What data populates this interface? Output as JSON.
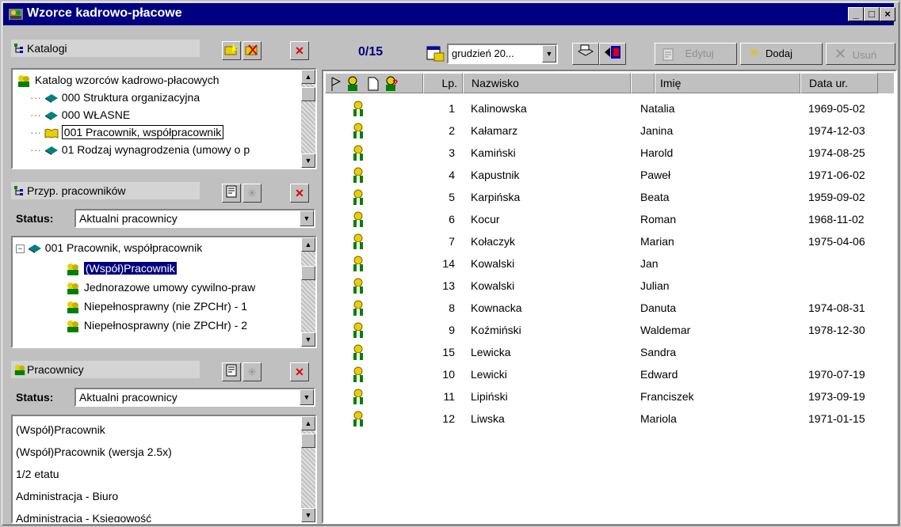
{
  "window": {
    "title": "Wzorce kadrowo-płacowe",
    "controls": [
      "_",
      "□",
      "×"
    ]
  },
  "katalogi": {
    "header": "Katalogi",
    "items": [
      {
        "label": "Katalog wzorców kadrowo-płacowych",
        "icon": "people-group-icon"
      },
      {
        "label": "000 Struktura organizacyjna",
        "icon": "book-icon"
      },
      {
        "label": "000 WŁASNE",
        "icon": "book-icon"
      },
      {
        "label": "001 Pracownik, współpracownik",
        "icon": "open-book-icon",
        "selected": true
      },
      {
        "label": "01 Rodzaj wynagrodzenia (umowy o p",
        "icon": "book-icon"
      }
    ]
  },
  "przyp": {
    "header": "Przyp. pracowników",
    "status_label": "Status:",
    "status_value": "Aktualni pracownicy",
    "items": [
      {
        "label": "001 Pracownik, współpracownik",
        "icon": "book-icon"
      },
      {
        "label": "(Współ)Pracownik",
        "icon": "people-group-icon",
        "selected": true
      },
      {
        "label": "Jednorazowe umowy cywilno-praw",
        "icon": "people-group-icon"
      },
      {
        "label": "Niepełnosprawny (nie ZPCHr) - 1",
        "icon": "people-group-icon"
      },
      {
        "label": "Niepełnosprawny (nie ZPCHr) - 2",
        "icon": "people-group-icon"
      }
    ]
  },
  "pracownicy": {
    "header": "Pracownicy",
    "status_label": "Status:",
    "status_value": "Aktualni pracownicy",
    "items": [
      "(Współ)Pracownik",
      "(Współ)Pracownik (wersja 2.5x)",
      "1/2 etatu",
      "Administracja - Biuro",
      "Administracja - Księgowość"
    ]
  },
  "toolbar": {
    "counter": "0/15",
    "month": "grudzień 20...",
    "edit_label": "Edytuj",
    "add_label": "Dodaj",
    "delete_label": "Usuń"
  },
  "grid": {
    "headers": {
      "lp": "Lp.",
      "surname": "Nazwisko",
      "name": "Imię",
      "dob": "Data ur."
    },
    "rows": [
      {
        "lp": "1",
        "surname": "Kalinowska",
        "name": "Natalia",
        "dob": "1969-05-02"
      },
      {
        "lp": "2",
        "surname": "Kałamarz",
        "name": "Janina",
        "dob": "1974-12-03"
      },
      {
        "lp": "3",
        "surname": "Kamiński",
        "name": "Harold",
        "dob": "1974-08-25"
      },
      {
        "lp": "4",
        "surname": "Kapustnik",
        "name": "Paweł",
        "dob": "1971-06-02"
      },
      {
        "lp": "5",
        "surname": "Karpińska",
        "name": "Beata",
        "dob": "1959-09-02"
      },
      {
        "lp": "6",
        "surname": "Kocur",
        "name": "Roman",
        "dob": "1968-11-02"
      },
      {
        "lp": "7",
        "surname": "Kołaczyk",
        "name": "Marian",
        "dob": "1975-04-06"
      },
      {
        "lp": "14",
        "surname": "Kowalski",
        "name": "Jan",
        "dob": ""
      },
      {
        "lp": "13",
        "surname": "Kowalski",
        "name": "Julian",
        "dob": ""
      },
      {
        "lp": "8",
        "surname": "Kownacka",
        "name": "Danuta",
        "dob": "1974-08-31"
      },
      {
        "lp": "9",
        "surname": "Koźmiński",
        "name": "Waldemar",
        "dob": "1978-12-30"
      },
      {
        "lp": "15",
        "surname": "Lewicka",
        "name": "Sandra",
        "dob": ""
      },
      {
        "lp": "10",
        "surname": "Lewicki",
        "name": "Edward",
        "dob": "1970-07-19"
      },
      {
        "lp": "11",
        "surname": "Lipiński",
        "name": "Franciszek",
        "dob": "1973-09-19"
      },
      {
        "lp": "12",
        "surname": "Liwska",
        "name": "Mariola",
        "dob": "1971-01-15"
      }
    ]
  },
  "colors": {
    "titlebar": "#000080",
    "selection": "#000080",
    "delete_red": "#e00000"
  }
}
